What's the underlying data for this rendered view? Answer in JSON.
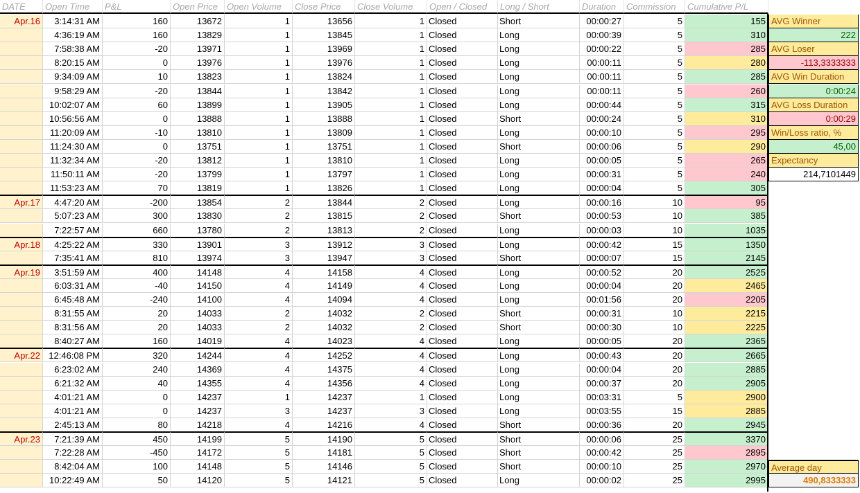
{
  "headers": [
    "DATE",
    "Open Time",
    "P&L",
    "Open Price",
    "Open Volume",
    "Close Price",
    "Close Volume",
    "Open / Closed",
    "Long / Short",
    "Duration",
    "Commission",
    "Cumulative P/L"
  ],
  "rows": [
    {
      "date": "Apr.16",
      "time": "3:14:31 AM",
      "pl": "160",
      "open_price": "13672",
      "open_vol": "1",
      "close_price": "13656",
      "close_vol": "1",
      "status": "Closed",
      "side": "Short",
      "duration": "00:00:27",
      "commission": "5",
      "cum": "155",
      "cum_color": "g"
    },
    {
      "date": "",
      "time": "4:36:19 AM",
      "pl": "160",
      "open_price": "13829",
      "open_vol": "1",
      "close_price": "13845",
      "close_vol": "1",
      "status": "Closed",
      "side": "Long",
      "duration": "00:00:39",
      "commission": "5",
      "cum": "310",
      "cum_color": "g"
    },
    {
      "date": "",
      "time": "7:58:38 AM",
      "pl": "-20",
      "open_price": "13971",
      "open_vol": "1",
      "close_price": "13969",
      "close_vol": "1",
      "status": "Closed",
      "side": "Long",
      "duration": "00:00:22",
      "commission": "5",
      "cum": "285",
      "cum_color": "rd"
    },
    {
      "date": "",
      "time": "8:20:15 AM",
      "pl": "0",
      "open_price": "13976",
      "open_vol": "1",
      "close_price": "13976",
      "close_vol": "1",
      "status": "Closed",
      "side": "Long",
      "duration": "00:00:11",
      "commission": "5",
      "cum": "280",
      "cum_color": "y"
    },
    {
      "date": "",
      "time": "9:34:09 AM",
      "pl": "10",
      "open_price": "13823",
      "open_vol": "1",
      "close_price": "13824",
      "close_vol": "1",
      "status": "Closed",
      "side": "Long",
      "duration": "00:00:11",
      "commission": "5",
      "cum": "285",
      "cum_color": "g"
    },
    {
      "date": "",
      "time": "9:58:29 AM",
      "pl": "-20",
      "open_price": "13844",
      "open_vol": "1",
      "close_price": "13842",
      "close_vol": "1",
      "status": "Closed",
      "side": "Long",
      "duration": "00:00:11",
      "commission": "5",
      "cum": "260",
      "cum_color": "rd"
    },
    {
      "date": "",
      "time": "10:02:07 AM",
      "pl": "60",
      "open_price": "13899",
      "open_vol": "1",
      "close_price": "13905",
      "close_vol": "1",
      "status": "Closed",
      "side": "Long",
      "duration": "00:00:44",
      "commission": "5",
      "cum": "315",
      "cum_color": "g"
    },
    {
      "date": "",
      "time": "10:56:56 AM",
      "pl": "0",
      "open_price": "13888",
      "open_vol": "1",
      "close_price": "13888",
      "close_vol": "1",
      "status": "Closed",
      "side": "Short",
      "duration": "00:00:24",
      "commission": "5",
      "cum": "310",
      "cum_color": "y"
    },
    {
      "date": "",
      "time": "11:20:09 AM",
      "pl": "-10",
      "open_price": "13810",
      "open_vol": "1",
      "close_price": "13809",
      "close_vol": "1",
      "status": "Closed",
      "side": "Long",
      "duration": "00:00:10",
      "commission": "5",
      "cum": "295",
      "cum_color": "rd"
    },
    {
      "date": "",
      "time": "11:24:30 AM",
      "pl": "0",
      "open_price": "13751",
      "open_vol": "1",
      "close_price": "13751",
      "close_vol": "1",
      "status": "Closed",
      "side": "Short",
      "duration": "00:00:06",
      "commission": "5",
      "cum": "290",
      "cum_color": "y"
    },
    {
      "date": "",
      "time": "11:32:34 AM",
      "pl": "-20",
      "open_price": "13812",
      "open_vol": "1",
      "close_price": "13810",
      "close_vol": "1",
      "status": "Closed",
      "side": "Long",
      "duration": "00:00:05",
      "commission": "5",
      "cum": "265",
      "cum_color": "rd"
    },
    {
      "date": "",
      "time": "11:50:11 AM",
      "pl": "-20",
      "open_price": "13799",
      "open_vol": "1",
      "close_price": "13797",
      "close_vol": "1",
      "status": "Closed",
      "side": "Long",
      "duration": "00:00:31",
      "commission": "5",
      "cum": "240",
      "cum_color": "rd"
    },
    {
      "date": "",
      "time": "11:53:23 AM",
      "pl": "70",
      "open_price": "13819",
      "open_vol": "1",
      "close_price": "13826",
      "close_vol": "1",
      "status": "Closed",
      "side": "Long",
      "duration": "00:00:04",
      "commission": "5",
      "cum": "305",
      "cum_color": "g"
    },
    {
      "date": "Apr.17",
      "time": "4:47:20 AM",
      "pl": "-200",
      "open_price": "13854",
      "open_vol": "2",
      "close_price": "13844",
      "close_vol": "2",
      "status": "Closed",
      "side": "Long",
      "duration": "00:00:16",
      "commission": "10",
      "cum": "95",
      "cum_color": "rd"
    },
    {
      "date": "",
      "time": "5:07:23 AM",
      "pl": "300",
      "open_price": "13830",
      "open_vol": "2",
      "close_price": "13815",
      "close_vol": "2",
      "status": "Closed",
      "side": "Short",
      "duration": "00:00:53",
      "commission": "10",
      "cum": "385",
      "cum_color": "g"
    },
    {
      "date": "",
      "time": "7:22:57 AM",
      "pl": "660",
      "open_price": "13780",
      "open_vol": "2",
      "close_price": "13813",
      "close_vol": "2",
      "status": "Closed",
      "side": "Long",
      "duration": "00:00:03",
      "commission": "10",
      "cum": "1035",
      "cum_color": "g"
    },
    {
      "date": "Apr.18",
      "time": "4:25:22 AM",
      "pl": "330",
      "open_price": "13901",
      "open_vol": "3",
      "close_price": "13912",
      "close_vol": "3",
      "status": "Closed",
      "side": "Long",
      "duration": "00:00:42",
      "commission": "15",
      "cum": "1350",
      "cum_color": "g"
    },
    {
      "date": "",
      "time": "7:35:41 AM",
      "pl": "810",
      "open_price": "13974",
      "open_vol": "3",
      "close_price": "13947",
      "close_vol": "3",
      "status": "Closed",
      "side": "Short",
      "duration": "00:00:07",
      "commission": "15",
      "cum": "2145",
      "cum_color": "g"
    },
    {
      "date": "Apr.19",
      "time": "3:51:59 AM",
      "pl": "400",
      "open_price": "14148",
      "open_vol": "4",
      "close_price": "14158",
      "close_vol": "4",
      "status": "Closed",
      "side": "Long",
      "duration": "00:00:52",
      "commission": "20",
      "cum": "2525",
      "cum_color": "g"
    },
    {
      "date": "",
      "time": "6:03:31 AM",
      "pl": "-40",
      "open_price": "14150",
      "open_vol": "4",
      "close_price": "14149",
      "close_vol": "4",
      "status": "Closed",
      "side": "Long",
      "duration": "00:00:04",
      "commission": "20",
      "cum": "2465",
      "cum_color": "y"
    },
    {
      "date": "",
      "time": "6:45:48 AM",
      "pl": "-240",
      "open_price": "14100",
      "open_vol": "4",
      "close_price": "14094",
      "close_vol": "4",
      "status": "Closed",
      "side": "Long",
      "duration": "00:01:56",
      "commission": "20",
      "cum": "2205",
      "cum_color": "rd"
    },
    {
      "date": "",
      "time": "8:31:55 AM",
      "pl": "20",
      "open_price": "14033",
      "open_vol": "2",
      "close_price": "14032",
      "close_vol": "2",
      "status": "Closed",
      "side": "Short",
      "duration": "00:00:31",
      "commission": "10",
      "cum": "2215",
      "cum_color": "y"
    },
    {
      "date": "",
      "time": "8:31:56 AM",
      "pl": "20",
      "open_price": "14033",
      "open_vol": "2",
      "close_price": "14032",
      "close_vol": "2",
      "status": "Closed",
      "side": "Short",
      "duration": "00:00:30",
      "commission": "10",
      "cum": "2225",
      "cum_color": "y"
    },
    {
      "date": "",
      "time": "8:40:27 AM",
      "pl": "160",
      "open_price": "14019",
      "open_vol": "4",
      "close_price": "14023",
      "close_vol": "4",
      "status": "Closed",
      "side": "Long",
      "duration": "00:00:05",
      "commission": "20",
      "cum": "2365",
      "cum_color": "g"
    },
    {
      "date": "Apr.22",
      "time": "12:46:08 PM",
      "pl": "320",
      "open_price": "14244",
      "open_vol": "4",
      "close_price": "14252",
      "close_vol": "4",
      "status": "Closed",
      "side": "Long",
      "duration": "00:00:43",
      "commission": "20",
      "cum": "2665",
      "cum_color": "g"
    },
    {
      "date": "",
      "time": "6:23:02 AM",
      "pl": "240",
      "open_price": "14369",
      "open_vol": "4",
      "close_price": "14375",
      "close_vol": "4",
      "status": "Closed",
      "side": "Long",
      "duration": "00:00:04",
      "commission": "20",
      "cum": "2885",
      "cum_color": "g"
    },
    {
      "date": "",
      "time": "6:21:32 AM",
      "pl": "40",
      "open_price": "14355",
      "open_vol": "4",
      "close_price": "14356",
      "close_vol": "4",
      "status": "Closed",
      "side": "Long",
      "duration": "00:00:37",
      "commission": "20",
      "cum": "2905",
      "cum_color": "g"
    },
    {
      "date": "",
      "time": "4:01:21 AM",
      "pl": "0",
      "open_price": "14237",
      "open_vol": "1",
      "close_price": "14237",
      "close_vol": "1",
      "status": "Closed",
      "side": "Long",
      "duration": "00:03:31",
      "commission": "5",
      "cum": "2900",
      "cum_color": "y"
    },
    {
      "date": "",
      "time": "4:01:21 AM",
      "pl": "0",
      "open_price": "14237",
      "open_vol": "3",
      "close_price": "14237",
      "close_vol": "3",
      "status": "Closed",
      "side": "Long",
      "duration": "00:03:55",
      "commission": "15",
      "cum": "2885",
      "cum_color": "y"
    },
    {
      "date": "",
      "time": "2:45:13 AM",
      "pl": "80",
      "open_price": "14218",
      "open_vol": "4",
      "close_price": "14216",
      "close_vol": "4",
      "status": "Closed",
      "side": "Short",
      "duration": "00:00:36",
      "commission": "20",
      "cum": "2945",
      "cum_color": "g"
    },
    {
      "date": "Apr.23",
      "time": "7:21:39 AM",
      "pl": "450",
      "open_price": "14199",
      "open_vol": "5",
      "close_price": "14190",
      "close_vol": "5",
      "status": "Closed",
      "side": "Short",
      "duration": "00:00:06",
      "commission": "25",
      "cum": "3370",
      "cum_color": "g"
    },
    {
      "date": "",
      "time": "7:22:28 AM",
      "pl": "-450",
      "open_price": "14172",
      "open_vol": "5",
      "close_price": "14181",
      "close_vol": "5",
      "status": "Closed",
      "side": "Short",
      "duration": "00:00:42",
      "commission": "25",
      "cum": "2895",
      "cum_color": "rd"
    },
    {
      "date": "",
      "time": "8:42:04 AM",
      "pl": "100",
      "open_price": "14148",
      "open_vol": "5",
      "close_price": "14146",
      "close_vol": "5",
      "status": "Closed",
      "side": "Short",
      "duration": "00:00:10",
      "commission": "25",
      "cum": "2970",
      "cum_color": "g"
    },
    {
      "date": "",
      "time": "10:22:49 AM",
      "pl": "50",
      "open_price": "14120",
      "open_vol": "5",
      "close_price": "14121",
      "close_vol": "5",
      "status": "Closed",
      "side": "Long",
      "duration": "00:00:02",
      "commission": "25",
      "cum": "2995",
      "cum_color": "g"
    }
  ],
  "stats": [
    {
      "label": "AVG Winner",
      "value": "222",
      "value_color": "g"
    },
    {
      "label": "AVG Loser",
      "value": "-113,3333333",
      "value_color": "rd"
    },
    {
      "label": "AVG Win Duration",
      "value": "0:00:24",
      "value_color": "g"
    },
    {
      "label": "AVG Loss Duration",
      "value": "0:00:29",
      "value_color": "rd"
    },
    {
      "label": "Win/Loss ratio, %",
      "value": "45,00",
      "value_color": "g"
    },
    {
      "label": "Expectancy",
      "value": "214,7101449",
      "value_color": "plain"
    }
  ],
  "average_day": {
    "label": "Average day",
    "value": "490,8333333"
  }
}
